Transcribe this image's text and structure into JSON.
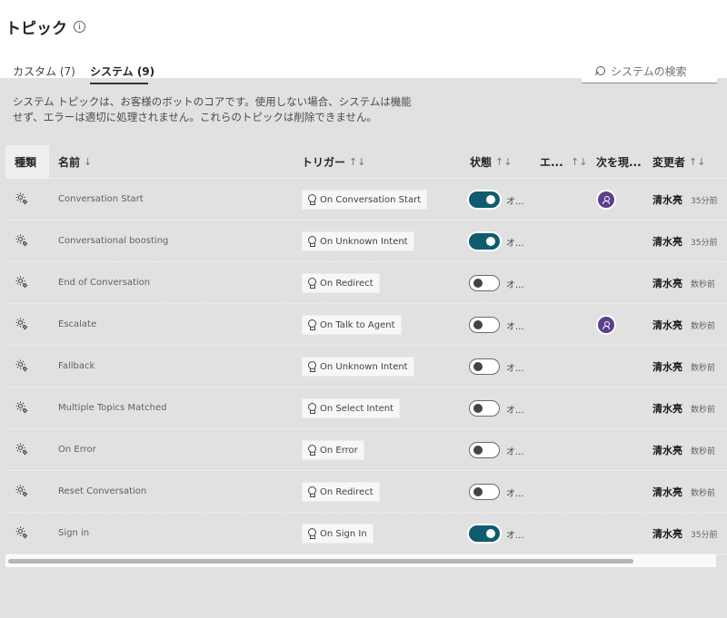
{
  "page": {
    "title": "トピック"
  },
  "tabs": [
    {
      "label": "カスタム (7)"
    },
    {
      "label": "システム (9)"
    }
  ],
  "search": {
    "placeholder": "システムの検索"
  },
  "description": "システム トピックは、お客様のボットのコアです。使用しない場合、システムは機能せず、エラーは適切に処理されません。これらのトピックは削除できません。",
  "columns": {
    "kind": "種類",
    "name": "名前",
    "trigger": "トリガー",
    "status": "状態",
    "error": "エ...",
    "next": "次を現...",
    "modifier": "変更者"
  },
  "rows": [
    {
      "name": "Conversation Start",
      "trigger": "On Conversation Start",
      "status_on": true,
      "status_label": "オ...",
      "has_avatar": true,
      "modifier": "清水亮",
      "modified": "35分前"
    },
    {
      "name": "Conversational boosting",
      "trigger": "On Unknown Intent",
      "status_on": true,
      "status_label": "オ...",
      "has_avatar": false,
      "modifier": "清水亮",
      "modified": "35分前"
    },
    {
      "name": "End of Conversation",
      "trigger": "On Redirect",
      "status_on": false,
      "status_label": "オ...",
      "has_avatar": false,
      "modifier": "清水亮",
      "modified": "数秒前"
    },
    {
      "name": "Escalate",
      "trigger": "On Talk to Agent",
      "status_on": false,
      "status_label": "オ...",
      "has_avatar": true,
      "modifier": "清水亮",
      "modified": "数秒前"
    },
    {
      "name": "Fallback",
      "trigger": "On Unknown Intent",
      "status_on": false,
      "status_label": "オ...",
      "has_avatar": false,
      "modifier": "清水亮",
      "modified": "数秒前"
    },
    {
      "name": "Multiple Topics Matched",
      "trigger": "On Select Intent",
      "status_on": false,
      "status_label": "オ...",
      "has_avatar": false,
      "modifier": "清水亮",
      "modified": "数秒前"
    },
    {
      "name": "On Error",
      "trigger": "On Error",
      "status_on": false,
      "status_label": "オ...",
      "has_avatar": false,
      "modifier": "清水亮",
      "modified": "数秒前"
    },
    {
      "name": "Reset Conversation",
      "trigger": "On Redirect",
      "status_on": false,
      "status_label": "オ...",
      "has_avatar": false,
      "modifier": "清水亮",
      "modified": "数秒前"
    },
    {
      "name": "Sign in",
      "trigger": "On Sign In",
      "status_on": true,
      "status_label": "オ...",
      "has_avatar": false,
      "modifier": "清水亮",
      "modified": "35分前"
    }
  ],
  "icons": {
    "info": "info-icon",
    "search": "search-icon",
    "kind": "system-topic-gear-icon",
    "trigger": "lightbulb-icon",
    "avatar": "person-icon",
    "sort": "sort-arrows-icon"
  },
  "colors": {
    "toggle_on": "#0f5c6e",
    "avatar": "#5b3f8a",
    "background": "#e1e1e1"
  }
}
